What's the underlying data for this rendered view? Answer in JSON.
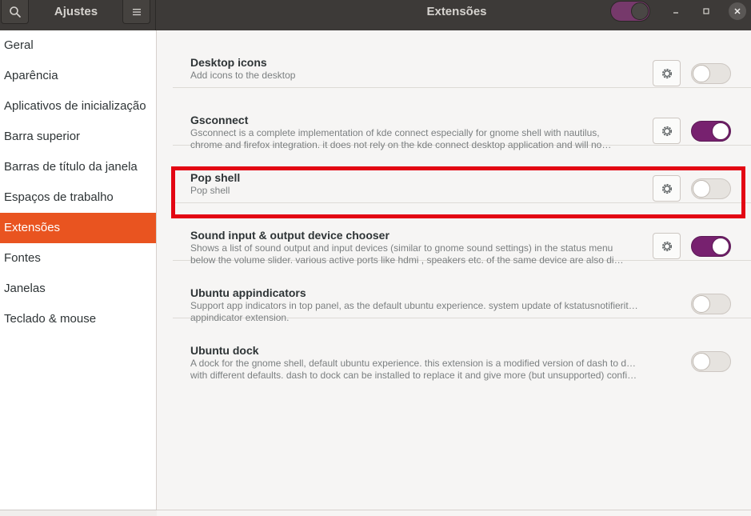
{
  "header": {
    "app_title": "Ajustes",
    "view_title": "Extensões",
    "master_switch_on": true
  },
  "sidebar": {
    "items": [
      {
        "label": "Geral",
        "active": false
      },
      {
        "label": "Aparência",
        "active": false
      },
      {
        "label": "Aplicativos de inicialização",
        "active": false
      },
      {
        "label": "Barra superior",
        "active": false
      },
      {
        "label": "Barras de título da janela",
        "active": false
      },
      {
        "label": "Espaços de trabalho",
        "active": false
      },
      {
        "label": "Extensões",
        "active": true
      },
      {
        "label": "Fontes",
        "active": false
      },
      {
        "label": "Janelas",
        "active": false
      },
      {
        "label": "Teclado & mouse",
        "active": false
      }
    ]
  },
  "extensions": [
    {
      "name": "Desktop icons",
      "desc": [
        "Add icons to the desktop"
      ],
      "has_settings": true,
      "enabled": false
    },
    {
      "name": "Gsconnect",
      "desc": [
        "Gsconnect is a complete implementation of kde connect especially for gnome shell with nautilus,",
        "chrome and firefox integration. it does not rely on the kde connect desktop application and will no…"
      ],
      "has_settings": true,
      "enabled": true
    },
    {
      "name": "Pop shell",
      "desc": [
        "Pop shell"
      ],
      "has_settings": true,
      "enabled": false
    },
    {
      "name": "Sound input & output device chooser",
      "desc": [
        "Shows a list of sound output and input devices (similar to gnome sound settings) in the status menu",
        "below the volume slider. various active ports like hdmi , speakers etc. of the same device are also di…"
      ],
      "has_settings": true,
      "enabled": true
    },
    {
      "name": "Ubuntu appindicators",
      "desc": [
        "Support app indicators in top panel, as the default ubuntu experience. system update of kstatusnotifieritem/-",
        "appindicator extension."
      ],
      "has_settings": false,
      "enabled": false
    },
    {
      "name": "Ubuntu dock",
      "desc": [
        "A dock for the gnome shell, default ubuntu experience. this extension is a modified version of dash to dock",
        "with different defaults. dash to dock can be installed to replace it and give more (but unsupported) configu…"
      ],
      "has_settings": false,
      "enabled": false
    }
  ],
  "colors": {
    "accent": "#e95420",
    "toggle_on": "#77216f",
    "highlight": "#e30613"
  },
  "icons": {
    "search": "search-icon",
    "menu": "hamburger-menu-icon",
    "settings": "gear-icon",
    "minimize": "minimize-icon",
    "maximize": "maximize-icon",
    "close": "close-icon"
  }
}
